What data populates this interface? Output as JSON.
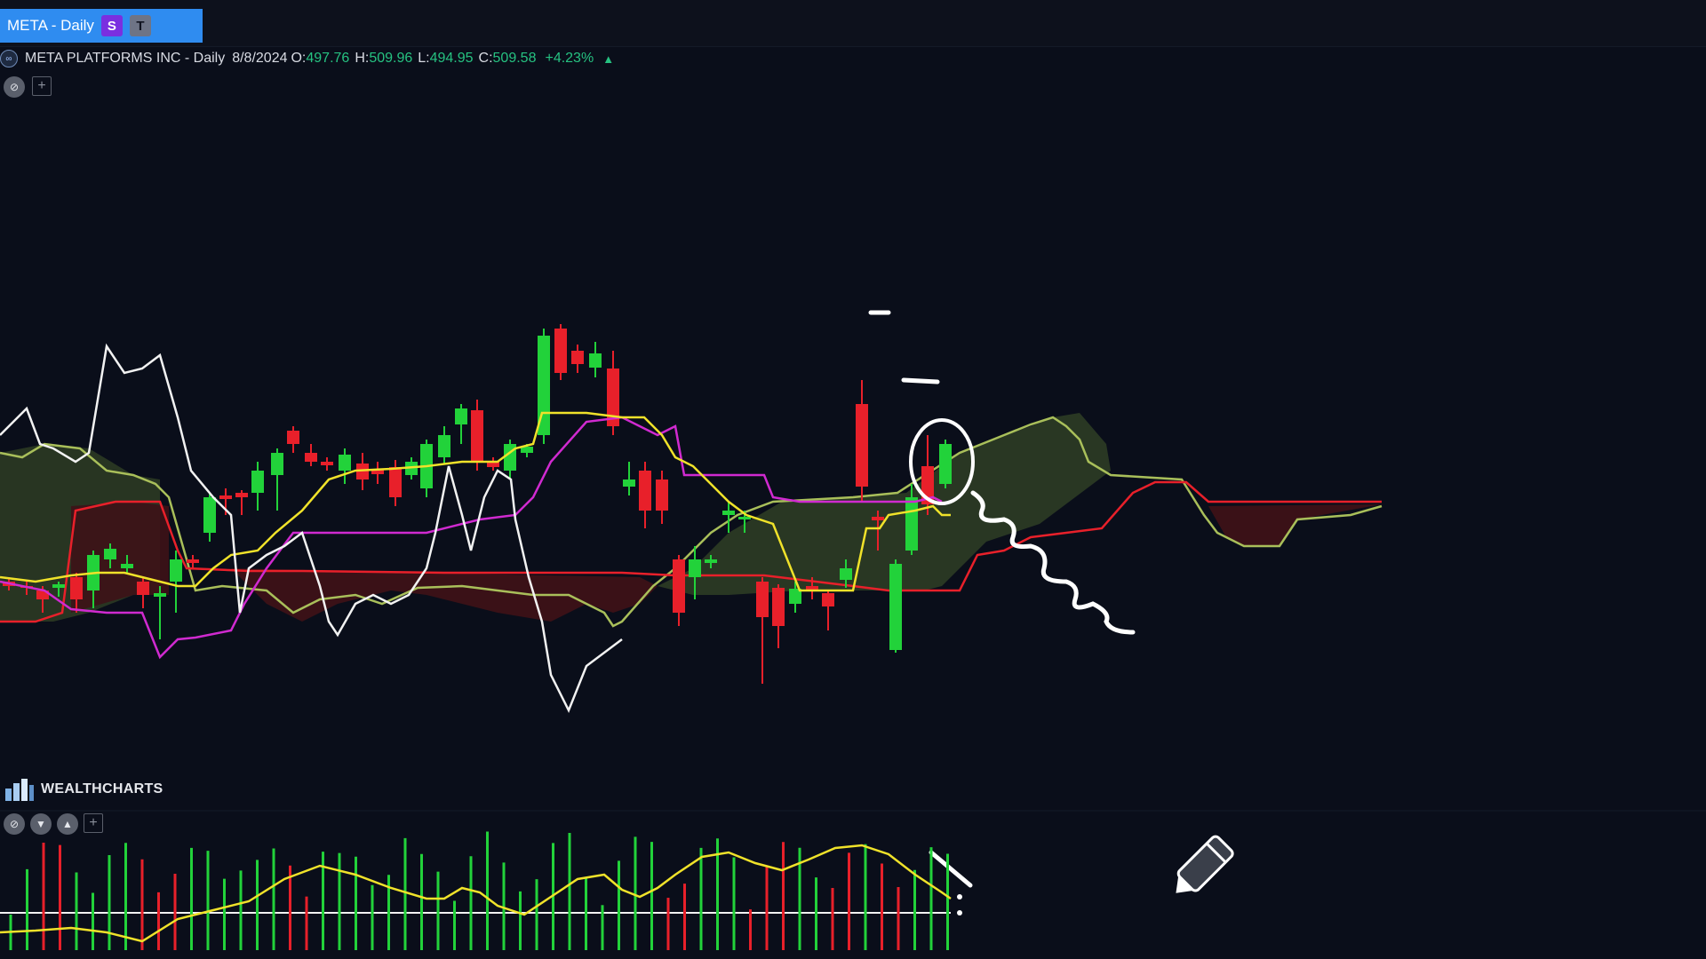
{
  "tab": {
    "label": "META - Daily",
    "badge_s": "S",
    "badge_t": "T"
  },
  "legend": {
    "symbol": "META PLATFORMS INC - Daily",
    "date": "8/8/2024",
    "open_key": "O:",
    "open": "497.76",
    "high_key": "H:",
    "high": "509.96",
    "low_key": "L:",
    "low": "494.95",
    "close_key": "C:",
    "close": "509.58",
    "change": "+4.23%"
  },
  "branding": {
    "name": "WEALTHCHARTS"
  },
  "icons": {
    "main_toggle": "eye-off-icon",
    "main_add": "plus-icon",
    "osc_toggle": "eye-off-icon",
    "osc_down": "chevron-down-icon",
    "osc_up": "chevron-up-icon",
    "osc_add": "plus-icon",
    "cursor": "pencil-icon"
  },
  "colors": {
    "background": "#0a0e1a",
    "tab": "#2f8cf0",
    "up": "#22d23a",
    "down": "#e8202a",
    "tenkan": "#f0e22a",
    "kijun": "#e8202a",
    "chikou": "#f2f2f2",
    "base": "#d02ad0",
    "span_b_line": "#a9bf5a",
    "cloud_bull": "#2b3a24",
    "cloud_bear": "#3d1217",
    "annotation": "#ffffff"
  },
  "chart_data": {
    "type": "candlestick",
    "title": "META PLATFORMS INC - Daily",
    "overlays": [
      "ichimoku cloud",
      "conversion line",
      "base line",
      "lagging span"
    ],
    "last_bar": {
      "date": "8/8/2024",
      "open": 497.76,
      "high": 509.96,
      "low": 494.95,
      "close": 509.58,
      "change_pct": 4.23
    },
    "oscillator": {
      "type": "histogram with signal line",
      "bars": 58
    },
    "annotations": [
      "circle around last candle",
      "downward squiggle arrow",
      "arrow on oscillator"
    ]
  }
}
